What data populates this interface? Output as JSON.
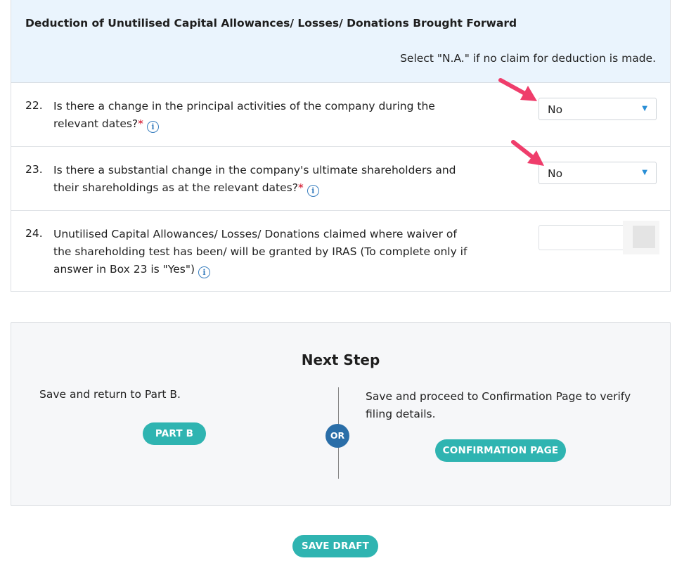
{
  "section": {
    "title": "Deduction of Unutilised Capital Allowances/ Losses/ Donations Brought Forward",
    "note": "Select \"N.A.\" if no claim for deduction is made."
  },
  "questions": [
    {
      "number": "22.",
      "text": "Is there a change in the principal activities of the company during the relevant dates?",
      "required_mark": "*",
      "info_icon": "i",
      "answer": "No"
    },
    {
      "number": "23.",
      "text": "Is there a substantial change in the company's ultimate shareholders and their shareholdings as at the relevant dates?",
      "required_mark": "*",
      "info_icon": "i",
      "answer": "No"
    },
    {
      "number": "24.",
      "text": "Unutilised Capital Allowances/ Losses/ Donations claimed where waiver of the shareholding test has been/ will be granted by IRAS (To complete only if answer in Box 23 is \"Yes\")",
      "info_icon": "i",
      "answer": ""
    }
  ],
  "next_step": {
    "title": "Next Step",
    "left_text": "Save and return to Part B.",
    "left_button": "PART B",
    "or_label": "OR",
    "right_text": "Save and proceed to Confirmation Page to verify filing details.",
    "right_button": "CONFIRMATION PAGE"
  },
  "save_draft_label": "SAVE DRAFT",
  "colors": {
    "header_bg": "#eaf4fd",
    "button_teal": "#2fb4b1",
    "or_circle": "#2a6ea8",
    "annotation_arrow": "#ef3d6b",
    "required": "#d0021b",
    "info": "#3a7fbf"
  },
  "icons": {
    "info": "info-circle-icon",
    "dropdown": "caret-down-icon",
    "annotation": "arrow-annotation"
  }
}
